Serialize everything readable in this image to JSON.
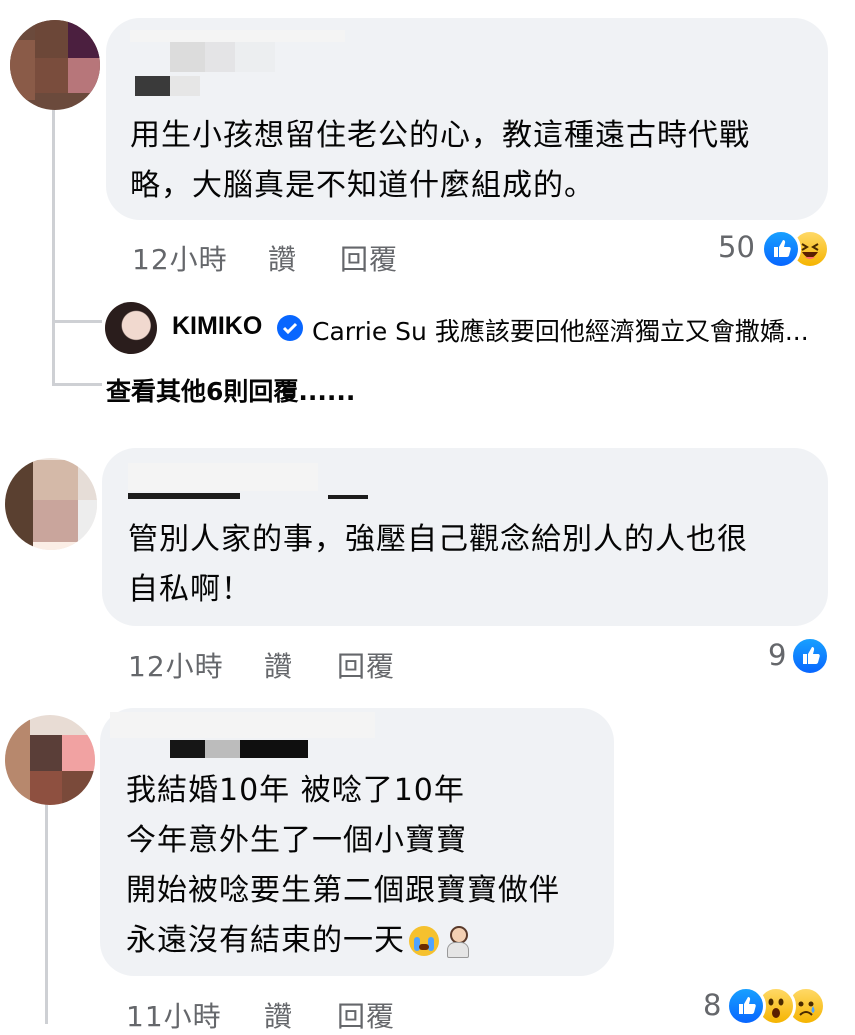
{
  "comments": [
    {
      "text_lines": [
        "用生小孩想留住老公的心，教這種遠古時代戰",
        "略，大腦真是不知道什麼組成的。"
      ],
      "time": "12小時",
      "like_label": "讚",
      "reply_label": "回覆",
      "reaction_count": "50",
      "reactions": [
        "like-icon",
        "haha-icon"
      ]
    },
    {
      "text_lines": [
        "管別人家的事，強壓自己觀念給別人的人也很",
        "自私啊！"
      ],
      "time": "12小時",
      "like_label": "讚",
      "reply_label": "回覆",
      "reaction_count": "9",
      "reactions": [
        "like-icon"
      ]
    },
    {
      "text_lines": [
        "我結婚10年 被唸了10年",
        "今年意外生了一個小寶寶",
        "開始被唸要生第二個跟寶寶做伴",
        "永遠沒有結束的一天"
      ],
      "time": "11小時",
      "like_label": "讚",
      "reply_label": "回覆",
      "reaction_count": "8",
      "reactions": [
        "like-icon",
        "wow-icon",
        "sad-icon"
      ]
    }
  ],
  "reply_preview": {
    "author": "KIMIKO",
    "text": "Carrie Su 我應該要回他經濟獨立又會撒嬌..."
  },
  "view_more_replies": "查看其他6則回覆......",
  "colors": {
    "bubble": "#f0f2f5",
    "meta_text": "#65676b",
    "like_blue": "#0866ff",
    "thread_line": "#ced0d4"
  }
}
